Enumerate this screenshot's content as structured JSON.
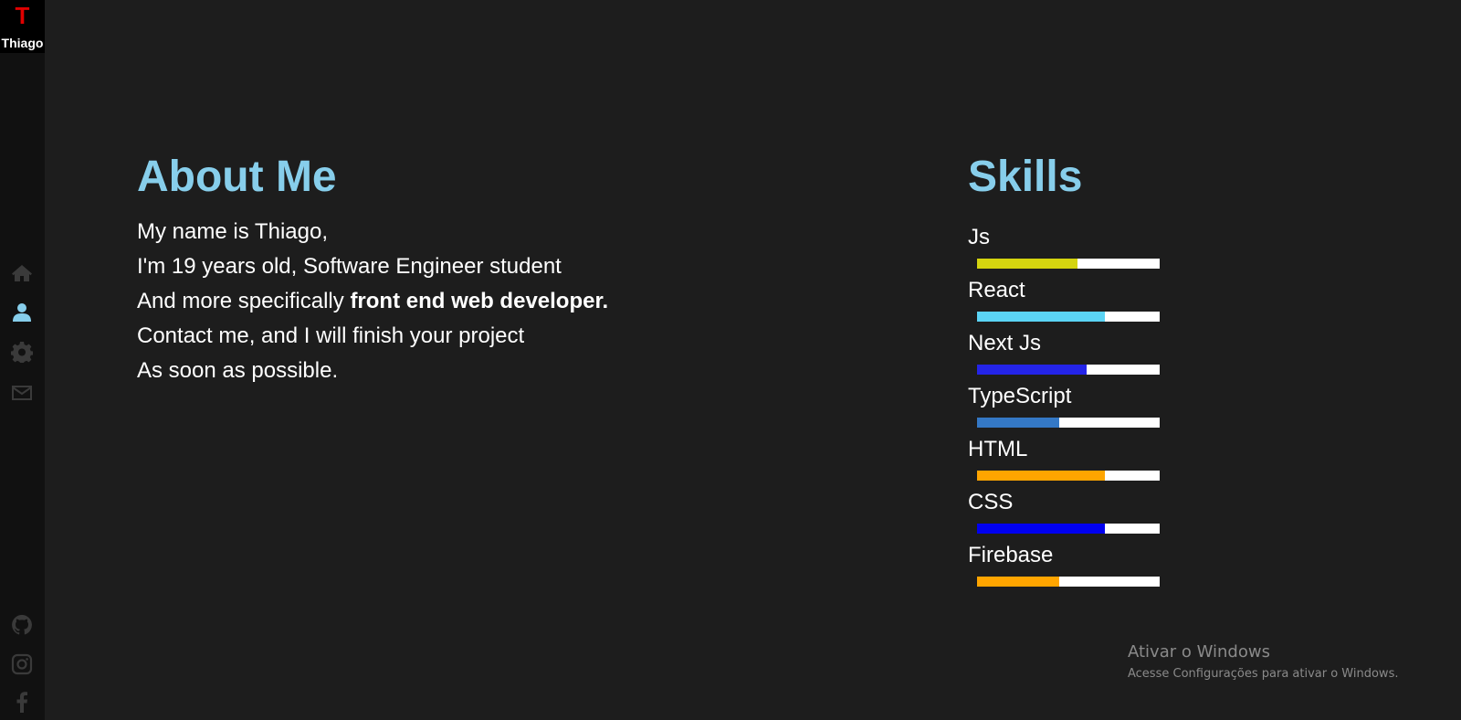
{
  "brand": {
    "letter": "T",
    "name": "Thiago",
    "letter_color": "#e00000"
  },
  "colors": {
    "accent": "#87ceeb",
    "nav_icon": "#3a3a3a",
    "nav_active": "#87ceeb"
  },
  "nav": [
    {
      "icon": "home-icon",
      "active": false
    },
    {
      "icon": "user-icon",
      "active": true
    },
    {
      "icon": "gear-icon",
      "active": false
    },
    {
      "icon": "envelope-icon",
      "active": false
    }
  ],
  "social": [
    {
      "icon": "github-icon"
    },
    {
      "icon": "instagram-icon"
    },
    {
      "icon": "facebook-icon"
    }
  ],
  "about": {
    "title": "About Me",
    "line1": "My name is Thiago,",
    "line2": "I'm 19 years old, Software Engineer student",
    "line3_prefix": "And more specifically ",
    "line3_bold": "front end web developer.",
    "line4": "Contact me, and I will finish your project",
    "line5": "As soon as possible."
  },
  "skills": {
    "title": "Skills",
    "items": [
      {
        "name": "Js",
        "level": 55,
        "color": "#d4d40f"
      },
      {
        "name": "React",
        "level": 70,
        "color": "#5bd4f5"
      },
      {
        "name": "Next Js",
        "level": 60,
        "color": "#2424e8"
      },
      {
        "name": "TypeScript",
        "level": 45,
        "color": "#3478c5"
      },
      {
        "name": "HTML",
        "level": 70,
        "color": "#ffa500"
      },
      {
        "name": "CSS",
        "level": 70,
        "color": "#0000f0"
      },
      {
        "name": "Firebase",
        "level": 45,
        "color": "#ffa500"
      }
    ]
  },
  "watermark": {
    "title": "Ativar o Windows",
    "subtitle": "Acesse Configurações para ativar o Windows."
  }
}
